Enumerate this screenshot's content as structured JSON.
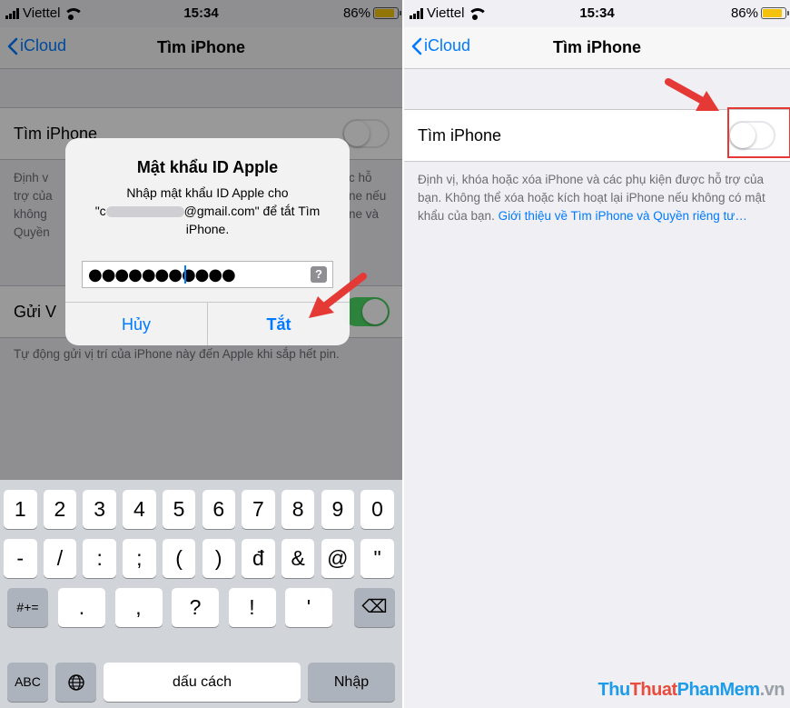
{
  "status": {
    "carrier": "Viettel",
    "time": "15:34",
    "battery": "86%"
  },
  "nav": {
    "back_label": "iCloud",
    "title": "Tìm iPhone"
  },
  "settings": {
    "find_label": "Tìm iPhone",
    "find_desc": "Định vị, khóa hoặc xóa iPhone và các phụ kiện được hỗ trợ của bạn. Không thể xóa hoặc kích hoạt lại iPhone nếu không có mật khẩu của bạn. ",
    "find_link": "Giới thiệu về Tìm iPhone và Quyền riêng tư…",
    "send_label": "Gửi V",
    "send_desc": "Tự động gửi vị trí của iPhone này đến Apple khi sắp hết pin.",
    "left_desc_fragment": "Định v\ntrợ của\nkhông\nQuyền",
    "left_desc_right": "c hỗ\nne nếu\nne và"
  },
  "alert": {
    "title": "Mật khẩu ID Apple",
    "msg_line1": "Nhập mật khẩu ID Apple cho",
    "msg_email_prefix": "\"c",
    "msg_email_suffix": "@gmail.com\" để tắt Tìm",
    "msg_line3": "iPhone.",
    "password_mask": "●●●●●●●●●●●",
    "help": "?",
    "cancel": "Hủy",
    "confirm": "Tắt"
  },
  "keyboard": {
    "row1": [
      "1",
      "2",
      "3",
      "4",
      "5",
      "6",
      "7",
      "8",
      "9",
      "0"
    ],
    "row2": [
      "-",
      "/",
      ":",
      ";",
      "(",
      ")",
      "đ",
      "&",
      "@",
      "\""
    ],
    "row3_left": "#+=",
    "row3": [
      ".",
      ",",
      "?",
      "!",
      "'"
    ],
    "row3_delete": "⌫",
    "abc": "ABC",
    "globe": "🌐",
    "space": "dấu cách",
    "enter": "Nhập"
  },
  "right_toggle_state": "off",
  "left_find_toggle": "off",
  "left_send_toggle": "on",
  "watermark": {
    "a": "Thu",
    "b": "Thuat",
    "c": "PhanMem",
    "d": ".vn"
  },
  "colors": {
    "accent": "#007aff",
    "switch_on": "#4cd964",
    "arrow": "#e53935"
  }
}
